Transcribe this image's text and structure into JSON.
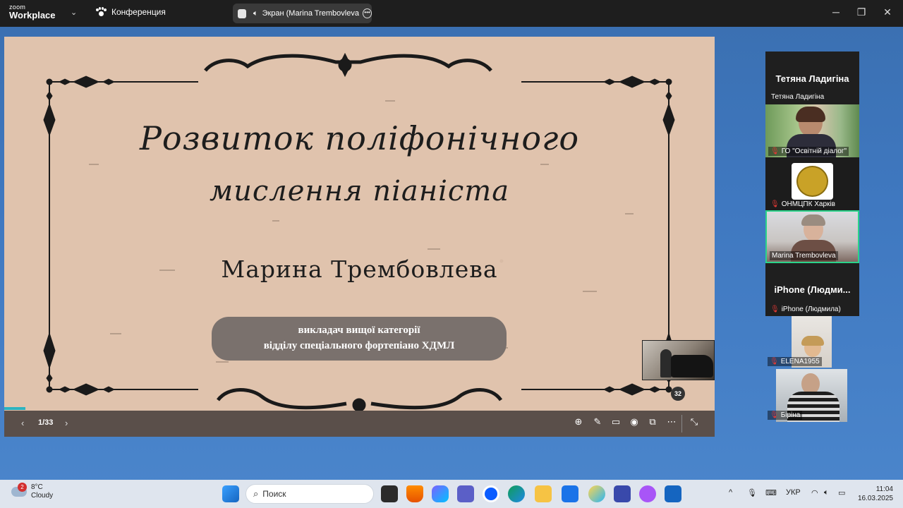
{
  "titlebar": {
    "brand_small": "zoom",
    "brand_big": "Workplace",
    "conference_label": "Конференция",
    "screen_tab_label": "Экран (Marina Trembovleva"
  },
  "slide": {
    "title_line1": "Розвиток поліфонічного",
    "title_line2": "мислення піаніста",
    "author": "Марина Трембовлева",
    "subtitle_line1": "викладач вищої категорії",
    "subtitle_line2": "відділу спеціального фортепіано ХДМЛ",
    "page_indicator": "1/33",
    "badge_count": "32",
    "progress_fraction": 0.03
  },
  "participants": [
    {
      "big_name": "Тетяна Ладигіна",
      "caption": "Тетяна Ладигіна"
    },
    {
      "caption": "ГО \"Освітній діалог\""
    },
    {
      "caption": "ОНМЦПК Харків"
    },
    {
      "caption": "Marina Trembovleva"
    },
    {
      "big_name": "iPhone (Людми...",
      "caption": "iPhone (Людмила)"
    },
    {
      "caption": "ELENA1955"
    },
    {
      "caption": "Біріна"
    }
  ],
  "taskbar": {
    "weather_temp": "8°C",
    "weather_desc": "Cloudy",
    "weather_badge": "2",
    "search_placeholder": "Поиск",
    "language": "УКР",
    "time": "11:04",
    "date": "16.03.2025"
  },
  "colors": {
    "slide_bg": "#e0c3ad",
    "pill_bg": "#7a716d",
    "active_speaker_border": "#2bd38a",
    "progress": "#2bb3c0"
  }
}
